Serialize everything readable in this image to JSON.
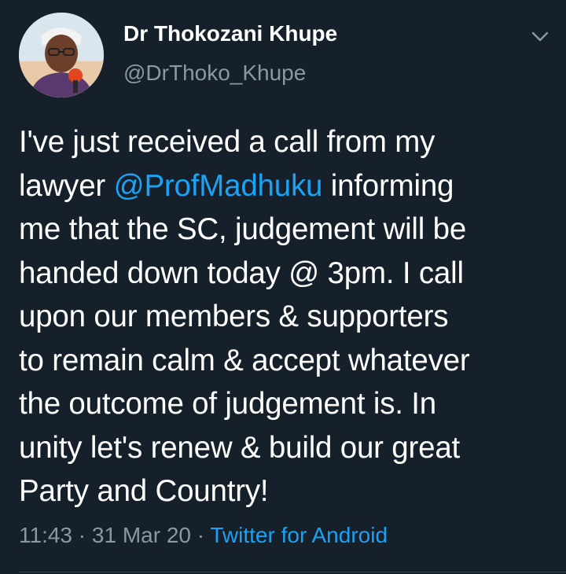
{
  "author": {
    "display_name": "Dr Thokozani Khupe",
    "handle": "@DrThoko_Khupe"
  },
  "tweet": {
    "lines": [
      {
        "before": "I've just received a call from my",
        "mention": "",
        "after": ""
      },
      {
        "before": "lawyer ",
        "mention": "@ProfMadhuku",
        "after": " informing"
      },
      {
        "before": "me that the SC, judgement will be",
        "mention": "",
        "after": ""
      },
      {
        "before": "handed down today @ 3pm. I call",
        "mention": "",
        "after": ""
      },
      {
        "before": "upon our members & supporters",
        "mention": "",
        "after": ""
      },
      {
        "before": "to remain calm & accept whatever",
        "mention": "",
        "after": ""
      },
      {
        "before": "the outcome of judgement is. In",
        "mention": "",
        "after": ""
      },
      {
        "before": "unity let's renew & build our great",
        "mention": "",
        "after": ""
      },
      {
        "before": "Party and Country!",
        "mention": "",
        "after": ""
      }
    ]
  },
  "meta": {
    "time": "11:43",
    "separator": " · ",
    "date": "31 Mar 20",
    "source": "Twitter for Android"
  },
  "icons": {
    "menu": "chevron-down-icon",
    "avatar": "profile-photo"
  },
  "colors": {
    "background": "#15202b",
    "text": "#ffffff",
    "secondary": "#8899a6",
    "link": "#1da1f2"
  }
}
